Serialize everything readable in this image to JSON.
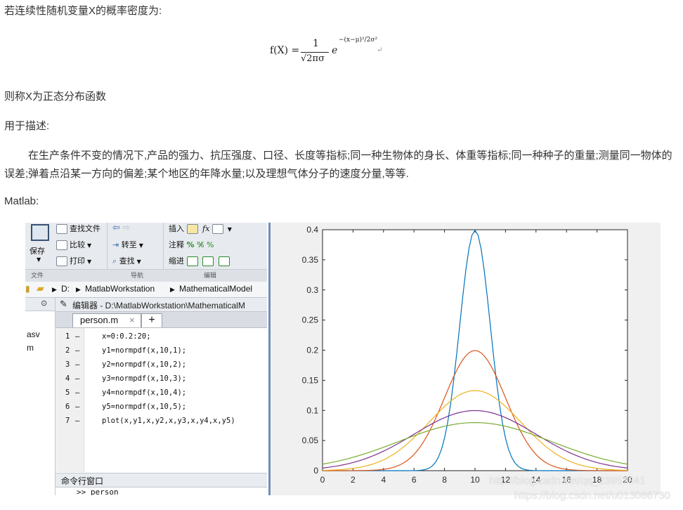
{
  "article": {
    "intro": "若连续性随机变量X的概率密度为:",
    "formula": {
      "lhs": "f(X) =",
      "numerator": "1",
      "denominator": "√2πσ",
      "base": "e",
      "exponent": "−(x−μ)²/2σ²",
      "return_mark": "↵"
    },
    "call": "则称X为正态分布函数",
    "use": "用于描述:",
    "desc": "在生产条件不变的情况下,产品的强力、抗压强度、口径、长度等指标;同一种生物体的身长、体重等指标;同一种种子的重量;测量同一物体的误差;弹着点沿某一方向的偏差;某个地区的年降水量;以及理想气体分子的速度分量,等等.",
    "matlab": "Matlab:"
  },
  "ribbon": {
    "save": "保存",
    "find_files": "查找文件",
    "compare": "比较",
    "print": "打印",
    "goto": "转至",
    "find": "查找",
    "insert": "插入",
    "comment": "注释",
    "indent": "缩进",
    "fx": "fx",
    "group_file": "文件",
    "group_nav": "导航",
    "group_edit": "编辑"
  },
  "path": {
    "drive": "D:",
    "folder1": "MatlabWorkstation",
    "folder2": "MathematicalModel"
  },
  "files": [
    "asv",
    "m"
  ],
  "editor": {
    "title": "编辑器 - D:\\MatlabWorkstation\\MathematicalM",
    "tab": "person.m",
    "tab_close": "×",
    "tab_add": "+",
    "lines": [
      {
        "n": "1",
        "code": "x=0:0.2:20;"
      },
      {
        "n": "2",
        "code": "y1=normpdf(x,10,1);"
      },
      {
        "n": "3",
        "code": "y2=normpdf(x,10,2);"
      },
      {
        "n": "4",
        "code": "y3=normpdf(x,10,3);"
      },
      {
        "n": "5",
        "code": "y4=normpdf(x,10,4);"
      },
      {
        "n": "6",
        "code": "y5=normpdf(x,10,5);"
      },
      {
        "n": "7",
        "code": "plot(x,y1,x,y2,x,y3,x,y4,x,y5)"
      }
    ],
    "cmd_title": "命令行窗口",
    "cmd_line": ">> person"
  },
  "watermark": {
    "line1": "http://blog.csdn.net/qq_23957341",
    "line2": "https://blog.csdn.net/u013066730"
  },
  "chart_data": {
    "type": "line",
    "x_range": [
      0,
      20
    ],
    "ylim": [
      0,
      0.4
    ],
    "x_ticks": [
      0,
      2,
      4,
      6,
      8,
      10,
      12,
      14,
      16,
      18,
      20
    ],
    "y_ticks": [
      0,
      0.05,
      0.1,
      0.15,
      0.2,
      0.25,
      0.3,
      0.35,
      0.4
    ],
    "y_tick_labels": [
      "0",
      "0.05",
      "0.1",
      "0.15",
      "0.2",
      "0.25",
      "0.3",
      "0.35",
      "0.4"
    ],
    "grid": false,
    "series": [
      {
        "mu": 10,
        "sigma": 1,
        "color": "#0072bd"
      },
      {
        "mu": 10,
        "sigma": 2,
        "color": "#d95319"
      },
      {
        "mu": 10,
        "sigma": 3,
        "color": "#edb120"
      },
      {
        "mu": 10,
        "sigma": 4,
        "color": "#7e2f8e"
      },
      {
        "mu": 10,
        "sigma": 5,
        "color": "#77ac30"
      }
    ],
    "x_step": 0.2
  }
}
